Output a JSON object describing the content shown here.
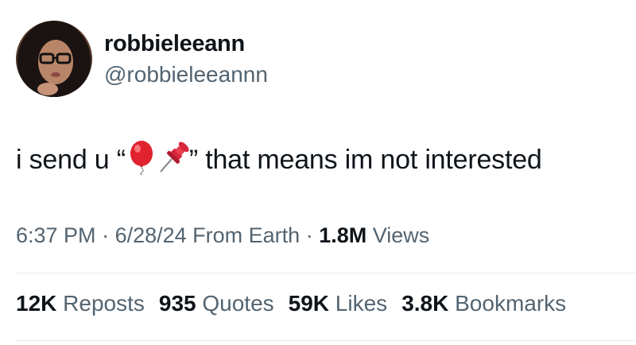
{
  "user": {
    "display_name": "robbieleeann",
    "handle": "@robbieleeannn",
    "avatar_icon": "profile-photo"
  },
  "tweet": {
    "text_before": "i send u “",
    "emoji_1": "balloon-emoji",
    "emoji_2": "pushpin-emoji",
    "text_after": "” that means im not interested"
  },
  "meta": {
    "time": "6:37 PM",
    "sep1": " · ",
    "date": "6/28/24",
    "source": " From Earth",
    "sep2": " · ",
    "views_count": "1.8M",
    "views_label": " Views"
  },
  "stats": [
    {
      "count": "12K",
      "label": " Reposts"
    },
    {
      "count": "935",
      "label": " Quotes"
    },
    {
      "count": "59K",
      "label": " Likes"
    },
    {
      "count": "3.8K",
      "label": " Bookmarks"
    }
  ],
  "colors": {
    "primary_text": "#0f1419",
    "secondary_text": "#536471",
    "divider": "#e6e9ec",
    "balloon_red": "#e0232e",
    "pin_red": "#d7263d"
  }
}
